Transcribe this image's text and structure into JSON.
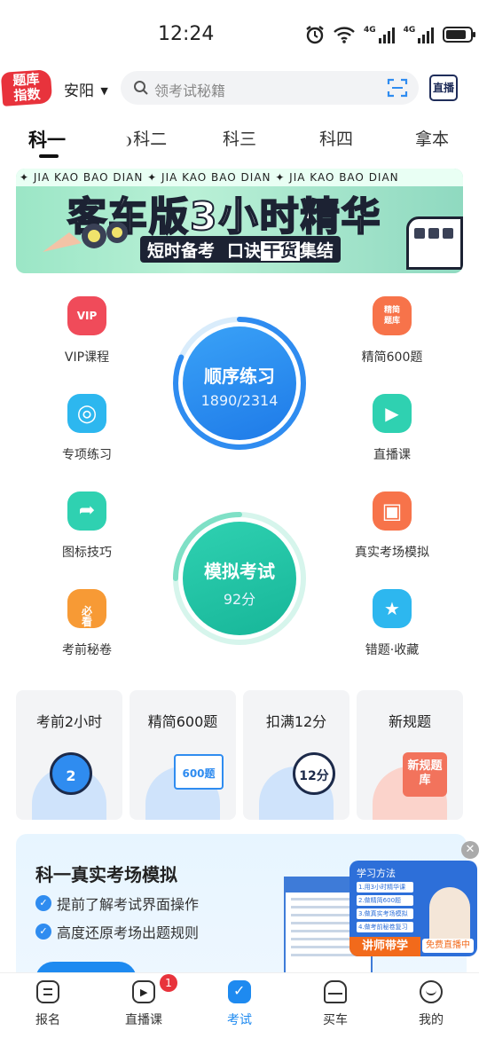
{
  "status_bar": {
    "time": "12:24",
    "net1": "4G",
    "net2": "4G"
  },
  "header": {
    "logo_line1": "题库",
    "logo_line2": "指数",
    "city": "安阳",
    "search_placeholder": "领考试秘籍",
    "live_label": "直播"
  },
  "tabs": [
    "科一",
    "科二",
    "科三",
    "科四",
    "拿本"
  ],
  "banner": {
    "ticker": "✦ JIA KAO BAO DIAN ✦ JIA KAO BAO DIAN ✦ JIA KAO BAO DIAN",
    "title": "客车版3小时精华",
    "sub1": "短时备考",
    "sub2": "口诀",
    "sub3": "干货",
    "sub4": "集结"
  },
  "features_left": [
    {
      "label": "VIP课程",
      "icon": "vip-icon",
      "glyph": "VIP",
      "color": "#f04b5a"
    },
    {
      "label": "专项练习",
      "icon": "target-icon",
      "glyph": "◎",
      "color": "#2db7ef"
    },
    {
      "label": "图标技巧",
      "icon": "arrow-sign-icon",
      "glyph": "➦",
      "color": "#2fd1b1"
    },
    {
      "label": "考前秘卷",
      "icon": "exam-paper-icon",
      "glyph": "必看",
      "color": "#f79a35"
    }
  ],
  "features_right": [
    {
      "label": "精简600题",
      "icon": "question-bank-icon",
      "glyph": "精简题库",
      "color": "#f7734a"
    },
    {
      "label": "直播课",
      "icon": "video-play-icon",
      "glyph": "▶",
      "color": "#2fd1b1"
    },
    {
      "label": "真实考场模拟",
      "icon": "monitor-icon",
      "glyph": "▣",
      "color": "#f7734a"
    },
    {
      "label": "错题·收藏",
      "icon": "star-bookmark-icon",
      "glyph": "★",
      "color": "#2db7ef"
    }
  ],
  "practice": {
    "title": "顺序练习",
    "done": 1890,
    "total": 2314,
    "progress_text": "1890/2314"
  },
  "mock": {
    "title": "模拟考试",
    "score": "92分"
  },
  "cards": [
    {
      "title": "考前2小时",
      "art": "2",
      "color": "#2f8cf0"
    },
    {
      "title": "精简600题",
      "art": "600题",
      "color": "#2f8cf0"
    },
    {
      "title": "扣满12分",
      "art": "12分",
      "color": "#2f8cf0"
    },
    {
      "title": "新规题",
      "art": "新规题库",
      "color": "#f2735c"
    }
  ],
  "promo": {
    "title": "科一真实考场模拟",
    "point1": "提前了解考试界面操作",
    "point2": "高度还原考场出题规则",
    "video_title": "学习方法",
    "video_items": [
      "1.用3小时精华课",
      "2.做精简600题",
      "3.做真实考场模拟",
      "4.做考前秘卷复习"
    ],
    "video_tag": "讲师带学",
    "video_live": "免费直播中"
  },
  "nav": [
    {
      "label": "报名",
      "icon": "signup-icon"
    },
    {
      "label": "直播课",
      "icon": "live-tv-icon"
    },
    {
      "label": "考试",
      "icon": "exam-icon"
    },
    {
      "label": "买车",
      "icon": "car-icon"
    },
    {
      "label": "我的",
      "icon": "profile-icon"
    }
  ],
  "nav_badge": "1",
  "colors": {
    "accent": "#1e8af0",
    "mint": "#2fd1b1",
    "red": "#e8333c"
  }
}
